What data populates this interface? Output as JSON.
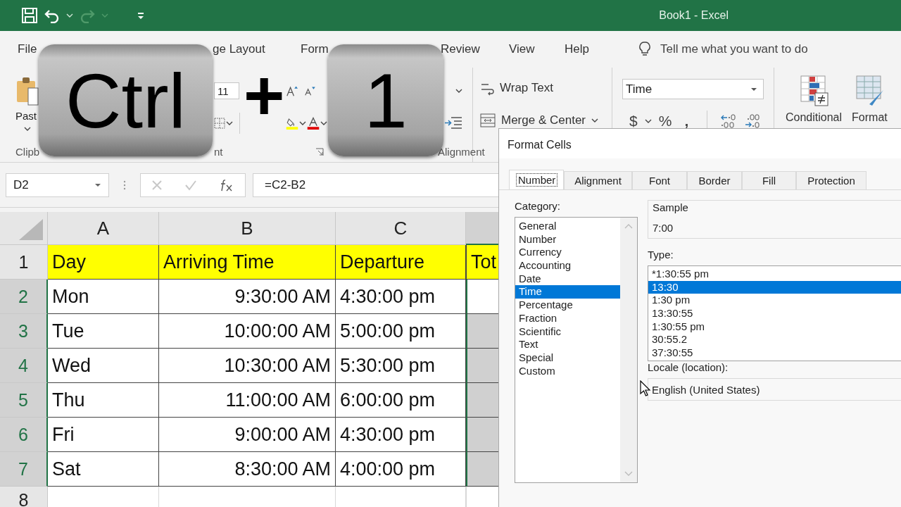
{
  "title_bar": {
    "title": "Book1  -  Excel"
  },
  "ribbon_tabs": [
    {
      "label": "File"
    },
    {
      "label": "ge Layout"
    },
    {
      "label": "Form"
    },
    {
      "label": "Review"
    },
    {
      "label": "View"
    },
    {
      "label": "Help"
    }
  ],
  "tell_me": "Tell me what you want to do",
  "ribbon": {
    "paste": "Past",
    "clipboard_group": "Clipb",
    "font_size": "11",
    "font_group": "nt",
    "alignment_group": "Alignment",
    "wrap_text": "Wrap Text",
    "merge_center": "Merge & Center",
    "number_format": "Time",
    "currency": "$",
    "percent": "%",
    "comma": ",",
    "conditional": "Conditional",
    "format_table": "Format"
  },
  "shortcut": {
    "keys": [
      "Ctrl",
      "1"
    ],
    "joiner": "+"
  },
  "formula_bar": {
    "name_box": "D2",
    "formula": "=C2-B2"
  },
  "sheet": {
    "columns": [
      "A",
      "B",
      "C"
    ],
    "rows": [
      {
        "number": "1",
        "cells": [
          "Day",
          "Arriving Time",
          "Departure"
        ],
        "total": "Tot",
        "header": true
      },
      {
        "number": "2",
        "cells": [
          "Mon",
          "9:30:00 AM",
          "4:30:00 pm"
        ],
        "selected": true,
        "active": true
      },
      {
        "number": "3",
        "cells": [
          "Tue",
          "10:00:00 AM",
          "5:00:00 pm"
        ],
        "selected": true,
        "active": false
      },
      {
        "number": "4",
        "cells": [
          "Wed",
          "10:30:00 AM",
          "5:30:00 pm"
        ],
        "selected": true,
        "active": false
      },
      {
        "number": "5",
        "cells": [
          "Thu",
          "11:00:00 AM",
          "6:00:00 pm"
        ],
        "selected": true,
        "active": false
      },
      {
        "number": "6",
        "cells": [
          "Fri",
          "9:00:00 AM",
          "4:30:00 pm"
        ],
        "selected": true,
        "active": false
      },
      {
        "number": "7",
        "cells": [
          "Sat",
          "8:30:00 AM",
          "4:00:00 pm"
        ],
        "selected": true,
        "active": false
      },
      {
        "number": "8",
        "cells": []
      }
    ]
  },
  "dialog": {
    "title": "Format Cells",
    "tabs": [
      {
        "label": "Number",
        "selected": true
      },
      {
        "label": "Alignment",
        "selected": false
      },
      {
        "label": "Font",
        "selected": false
      },
      {
        "label": "Border",
        "selected": false
      },
      {
        "label": "Fill",
        "selected": false
      },
      {
        "label": "Protection",
        "selected": false
      }
    ],
    "category_label": "Category:",
    "categories": [
      {
        "label": "General",
        "selected": false
      },
      {
        "label": "Number",
        "selected": false
      },
      {
        "label": "Currency",
        "selected": false
      },
      {
        "label": "Accounting",
        "selected": false
      },
      {
        "label": "Date",
        "selected": false
      },
      {
        "label": "Time",
        "selected": true
      },
      {
        "label": "Percentage",
        "selected": false
      },
      {
        "label": "Fraction",
        "selected": false
      },
      {
        "label": "Scientific",
        "selected": false
      },
      {
        "label": "Text",
        "selected": false
      },
      {
        "label": "Special",
        "selected": false
      },
      {
        "label": "Custom",
        "selected": false
      }
    ],
    "sample_label": "Sample",
    "sample": "7:00",
    "type_label": "Type:",
    "types": [
      {
        "label": "*1:30:55 pm",
        "selected": false
      },
      {
        "label": "13:30",
        "selected": true
      },
      {
        "label": "1:30 pm",
        "selected": false
      },
      {
        "label": "13:30:55",
        "selected": false
      },
      {
        "label": "1:30:55 pm",
        "selected": false
      },
      {
        "label": "30:55.2",
        "selected": false
      },
      {
        "label": "37:30:55",
        "selected": false
      }
    ],
    "locale_label": "Locale (location):",
    "locale": "English (United States)"
  }
}
